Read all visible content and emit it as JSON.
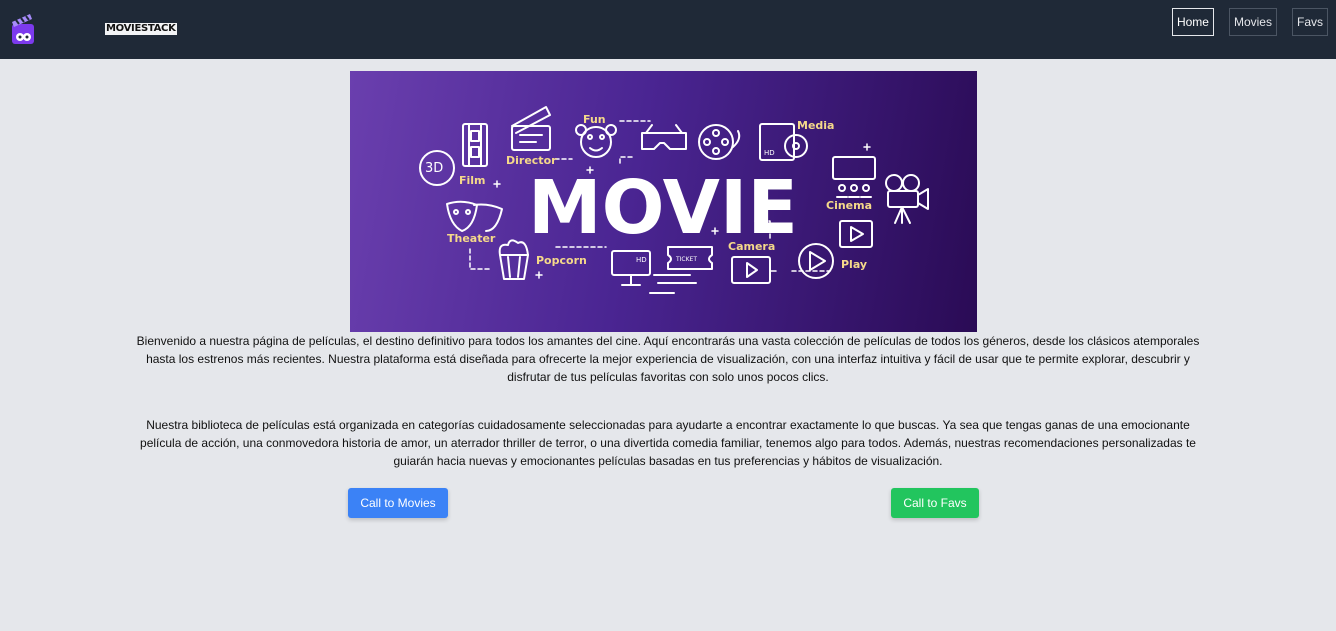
{
  "header": {
    "brand": "MOVIESTACK",
    "nav": [
      "Home",
      "Movies",
      "Favs"
    ]
  },
  "hero": {
    "title": "MOVIE",
    "labels": [
      "Fun",
      "Director",
      "Media",
      "3D",
      "Film",
      "Cinema",
      "Theater",
      "Camera",
      "Popcorn",
      "Play",
      "HD",
      "TICKET",
      "HD"
    ]
  },
  "content": {
    "paragraph1": "Bienvenido a nuestra página de películas, el destino definitivo para todos los amantes del cine. Aquí encontrarás una vasta colección de películas de todos los géneros, desde los clásicos atemporales hasta los estrenos más recientes. Nuestra plataforma está diseñada para ofrecerte la mejor experiencia de visualización, con una interfaz intuitiva y fácil de usar que te permite explorar, descubrir y disfrutar de tus películas favoritas con solo unos pocos clics.",
    "paragraph2": "Nuestra biblioteca de películas está organizada en categorías cuidadosamente seleccionadas para ayudarte a encontrar exactamente lo que buscas. Ya sea que tengas ganas de una emocionante película de acción, una conmovedora historia de amor, un aterrador thriller de terror, o una divertida comedia familiar, tenemos algo para todos. Además, nuestras recomendaciones personalizadas te guiarán hacia nuevas y emocionantes películas basadas en tus preferencias y hábitos de visualización."
  },
  "buttons": {
    "movies": "Call to Movies",
    "favs": "Call to Favs"
  },
  "colors": {
    "header_bg": "#1f2937",
    "page_bg": "#e5e7eb",
    "movies_button": "#3b82f6",
    "favs_button": "#22c55e",
    "hero_label": "#f5d98a"
  },
  "icons": [
    "clapperboard-logo-icon",
    "film-strip-icon",
    "clapperboard-icon",
    "clown-icon",
    "3d-glasses-icon",
    "film-reel-icon",
    "hd-disc-icon",
    "cinema-screen-icon",
    "movie-camera-icon",
    "theater-masks-icon",
    "popcorn-icon",
    "hd-monitor-icon",
    "ticket-icon",
    "video-player-icon",
    "play-icon"
  ]
}
